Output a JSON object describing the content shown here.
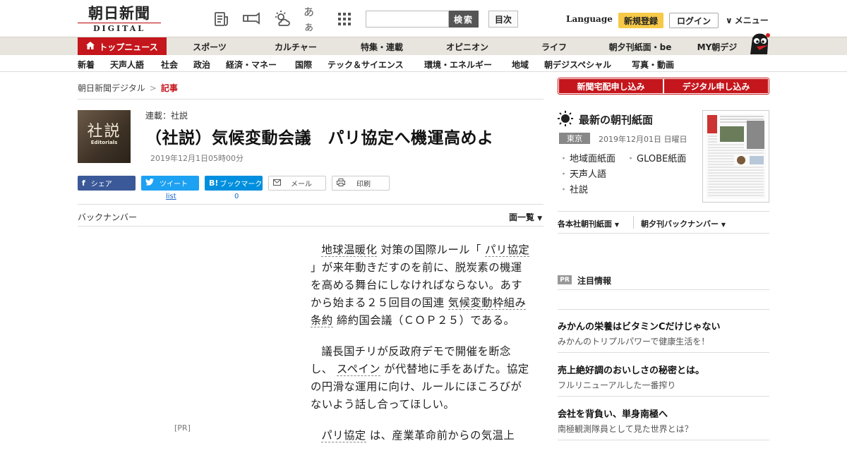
{
  "header": {
    "logo_jp": "朝日新聞",
    "logo_en": "DIGITAL",
    "search_button": "検索",
    "toc_button": "目次",
    "language": "Language",
    "register": "新規登録",
    "login": "ログイン",
    "menu": "メニュー",
    "font_size_icon": "あぁ",
    "colors": {
      "brand_red": "#c4161c",
      "register_yellow": "#f6c948"
    }
  },
  "nav": {
    "top_news": "トップニュース",
    "items": [
      "スポーツ",
      "カルチャー",
      "特集・連載",
      "オピニオン",
      "ライフ",
      "朝夕刊紙面・be",
      "MY朝デジ"
    ]
  },
  "subnav": {
    "items": [
      "新着",
      "天声人語",
      "社会",
      "政治",
      "経済・マネー",
      "国際",
      "テック＆サイエンス",
      "環境・エネルギー",
      "地域",
      "朝デジスペシャル",
      "写真・動画"
    ]
  },
  "breadcrumb": {
    "home": "朝日新聞デジタル",
    "sep": ">",
    "current": "記事"
  },
  "article": {
    "thumb_kanji": "社説",
    "thumb_en": "Editorials",
    "series": "連載：社説",
    "title": "（社説）気候変動会議　パリ協定へ機運高めよ",
    "date": "2019年12月1日05時00分",
    "share": {
      "facebook": "シェア",
      "twitter": "ツイート",
      "hatena": "ブックマーク",
      "mail": "メール",
      "print": "印刷",
      "twitter_count": "list",
      "hatena_count": "0"
    },
    "backnumber": "バックナンバー",
    "page_list": "面一覧",
    "ad_label": "[PR]",
    "paragraphs": [
      {
        "before": "",
        "link": "地球温暖化",
        "mid": " 対策の国際ルール「 ",
        "link2": "パリ協定",
        "after": " 」が来年動きだすのを前に、脱炭素の機運を高める舞台にしなければならない。あすから始まる２５回目の国連 ",
        "link3": "気候変動枠組み条約",
        "after2": " 締約国会議（ＣＯＰ２５）である。"
      },
      {
        "before": "議長国チリが反政府デモで開催を断念し、 ",
        "link": "スペイン",
        "after": " が代替地に手をあげた。協定の円滑な運用に向け、ルールにほころびがないよう話し合ってほしい。"
      },
      {
        "before": "",
        "link": "パリ協定",
        "after": " は、産業革命前からの気温上"
      }
    ]
  },
  "sidebar": {
    "subscribe_paper": "新聞宅配申し込み",
    "subscribe_digital": "デジタル申し込み",
    "latest_title": "最新の朝刊紙面",
    "region": "東京",
    "paper_date": "2019年12月01日 日曜日",
    "paper_links": [
      "地域面紙面",
      "GLOBE紙面",
      "天声人語",
      "社説"
    ],
    "dropdown_1": "各本社朝刊紙面",
    "dropdown_2": "朝夕刊バックナンバー",
    "pr_badge": "PR",
    "pr_title": "注目情報",
    "pr_items": [
      {
        "title": "みかんの栄養はビタミンCだけじゃない",
        "sub": "みかんのトリプルパワーで健康生活を！"
      },
      {
        "title": "売上絶好調のおいしさの秘密とは。",
        "sub": "フルリニューアルした一番搾り"
      },
      {
        "title": "会社を背負い、単身南極へ",
        "sub": "南極観測隊員として見た世界とは？"
      }
    ]
  }
}
